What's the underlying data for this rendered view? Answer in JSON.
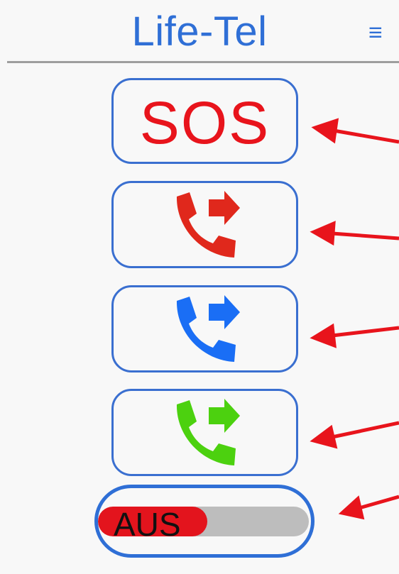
{
  "header": {
    "title": "Life-Tel",
    "menu_icon": "hamburger-menu-icon"
  },
  "buttons": {
    "sos_label": "SOS",
    "call_buttons": [
      {
        "icon": "phone-forward-icon",
        "color": "#e0281c"
      },
      {
        "icon": "phone-forward-icon",
        "color": "#1a6ef5"
      },
      {
        "icon": "phone-forward-icon",
        "color": "#4cd10f"
      }
    ]
  },
  "toggle": {
    "label": "AUS",
    "state": "off",
    "fill_fraction": 0.52,
    "fill_color": "#e3141d"
  },
  "annotations": {
    "arrow_color": "#e8141c",
    "arrow_count": 5
  },
  "colors": {
    "accent": "#2f6fd6",
    "sos_red": "#e8141c"
  }
}
